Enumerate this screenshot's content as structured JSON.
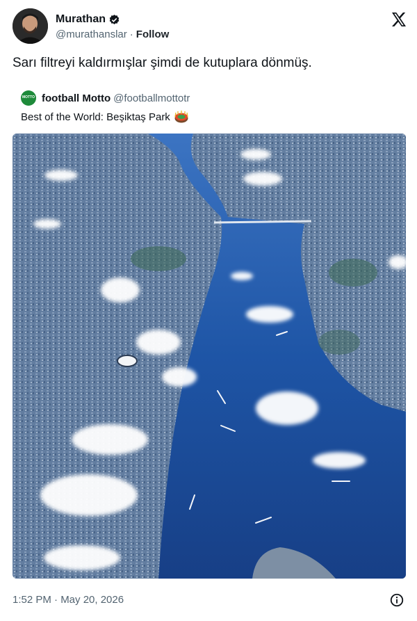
{
  "author": {
    "name": "Murathan",
    "handle": "@murathanslar",
    "separator": "·",
    "follow_label": "Follow",
    "verified_icon": "verified-badge-icon",
    "logo_icon": "x-logo-icon"
  },
  "tweet": {
    "text": "Sarı filtreyi kaldırmışlar şimdi de kutuplara dönmüş."
  },
  "quoted": {
    "name": "football Motto",
    "handle": "@footballmottotr",
    "avatar_text": "MOTTO",
    "text": "Best of the World: Beşiktaş Park",
    "emoji_icon": "stadium-emoji-icon"
  },
  "footer": {
    "timestamp": "1:52 PM · May 20, 2026",
    "info_icon": "info-icon"
  },
  "colors": {
    "text": "#0f1419",
    "muted": "#536471",
    "water": "#1f4f9e",
    "land": "#6a86a8"
  }
}
